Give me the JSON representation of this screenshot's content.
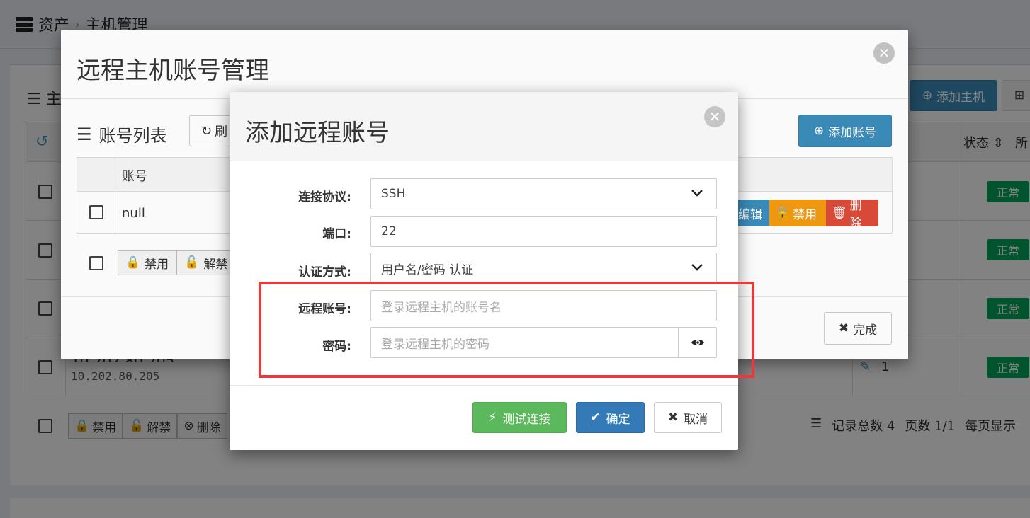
{
  "background": {
    "breadcrumb": [
      "资产",
      "主机管理"
    ],
    "panel_title": "主",
    "add_host_label": "添加主机",
    "status_column": "状态",
    "more_column": "所",
    "status_badges": [
      "正常",
      "正常",
      "正常",
      "正常"
    ],
    "ip_top": "10.202.80.205",
    "ip": "10.202.80.205",
    "edit_count": "1",
    "bulk_buttons": [
      "禁用",
      "解禁",
      "删除"
    ],
    "stats": {
      "total": "记录总数 4",
      "pages": "页数 1/1",
      "per_page": "每页显示"
    }
  },
  "account_modal": {
    "title": "远程主机账号管理",
    "list_title": "账号列表",
    "refresh_label": "刷",
    "add_account_label": "添加账号",
    "table": {
      "headers": [
        "账号"
      ],
      "rows": [
        [
          "null"
        ]
      ]
    },
    "row_actions": {
      "edit": "编辑",
      "disable": "禁用",
      "delete": "删除"
    },
    "bulk_buttons": [
      "禁用",
      "解禁"
    ],
    "done_label": "完成"
  },
  "add_modal": {
    "title": "添加远程账号",
    "fields": {
      "protocol": {
        "label": "连接协议:",
        "value": "SSH"
      },
      "port": {
        "label": "端口:",
        "value": "22"
      },
      "auth": {
        "label": "认证方式:",
        "value": "用户名/密码 认证"
      },
      "account": {
        "label": "远程账号:",
        "placeholder": "登录远程主机的账号名"
      },
      "password": {
        "label": "密码:",
        "placeholder": "登录远程主机的密码"
      }
    },
    "buttons": {
      "test": "测试连接",
      "ok": "确定",
      "cancel": "取消"
    }
  },
  "colors": {
    "primary": "#3c8dbc",
    "success": "#5cb85c",
    "warning": "#f39c12",
    "danger": "#dd4b39",
    "highlight": "#e83a3a"
  }
}
